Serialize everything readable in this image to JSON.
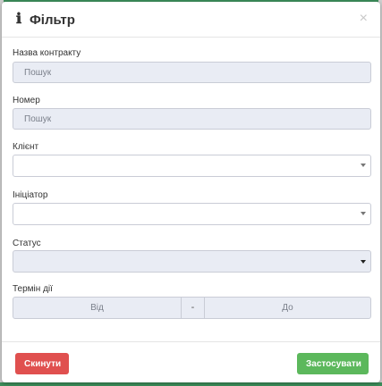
{
  "modal": {
    "title": "Фільтр",
    "info_icon": "ℹ",
    "close_icon": "×"
  },
  "fields": {
    "contract_name": {
      "label": "Назва контракту",
      "placeholder": "Пошук",
      "value": ""
    },
    "number": {
      "label": "Номер",
      "placeholder": "Пошук",
      "value": ""
    },
    "client": {
      "label": "Клієнт",
      "value": ""
    },
    "initiator": {
      "label": "Ініціатор",
      "value": ""
    },
    "status": {
      "label": "Статус",
      "value": ""
    },
    "validity": {
      "label": "Термін дії",
      "from_placeholder": "Від",
      "separator": "-",
      "to_placeholder": "До"
    }
  },
  "footer": {
    "reset_label": "Скинути",
    "apply_label": "Застосувати"
  },
  "colors": {
    "reset_button": "#e0504f",
    "apply_button": "#5cb85c",
    "input_background": "#e9ecf4",
    "frame_accent": "#3c8d5a"
  },
  "icons": [
    "info-icon",
    "close-icon",
    "chevron-down-icon"
  ]
}
